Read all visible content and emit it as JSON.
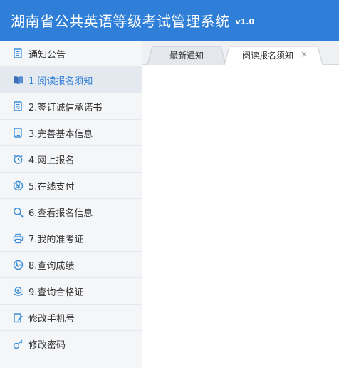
{
  "header": {
    "title": "湖南省公共英语等级考试管理系统",
    "version": "v1.0"
  },
  "sidebar": {
    "items": [
      {
        "label": "通知公告",
        "icon": "notice-icon"
      },
      {
        "label": "1.阅读报名须知",
        "icon": "book-icon",
        "active": true
      },
      {
        "label": "2.签订诚信承诺书",
        "icon": "document-icon"
      },
      {
        "label": "3.完善基本信息",
        "icon": "form-icon"
      },
      {
        "label": "4.网上报名",
        "icon": "alarm-clock-icon"
      },
      {
        "label": "5.在线支付",
        "icon": "payment-icon"
      },
      {
        "label": "6.查看报名信息",
        "icon": "search-icon"
      },
      {
        "label": "7.我的准考证",
        "icon": "printer-icon"
      },
      {
        "label": "8.查询成绩",
        "icon": "score-icon"
      },
      {
        "label": "9.查询合格证",
        "icon": "certificate-icon"
      },
      {
        "label": "修改手机号",
        "icon": "edit-icon"
      },
      {
        "label": "修改密码",
        "icon": "key-icon"
      }
    ]
  },
  "tabs": [
    {
      "label": "最新通知",
      "active": false
    },
    {
      "label": "阅读报名须知",
      "active": true,
      "closable": true,
      "close_glyph": "×"
    }
  ],
  "colors": {
    "header": "#2f7fd8",
    "icon_blue": "#3d8fd8",
    "sidebar_bg": "#f5f6f8",
    "active_item_bg": "#e4e9f0"
  }
}
